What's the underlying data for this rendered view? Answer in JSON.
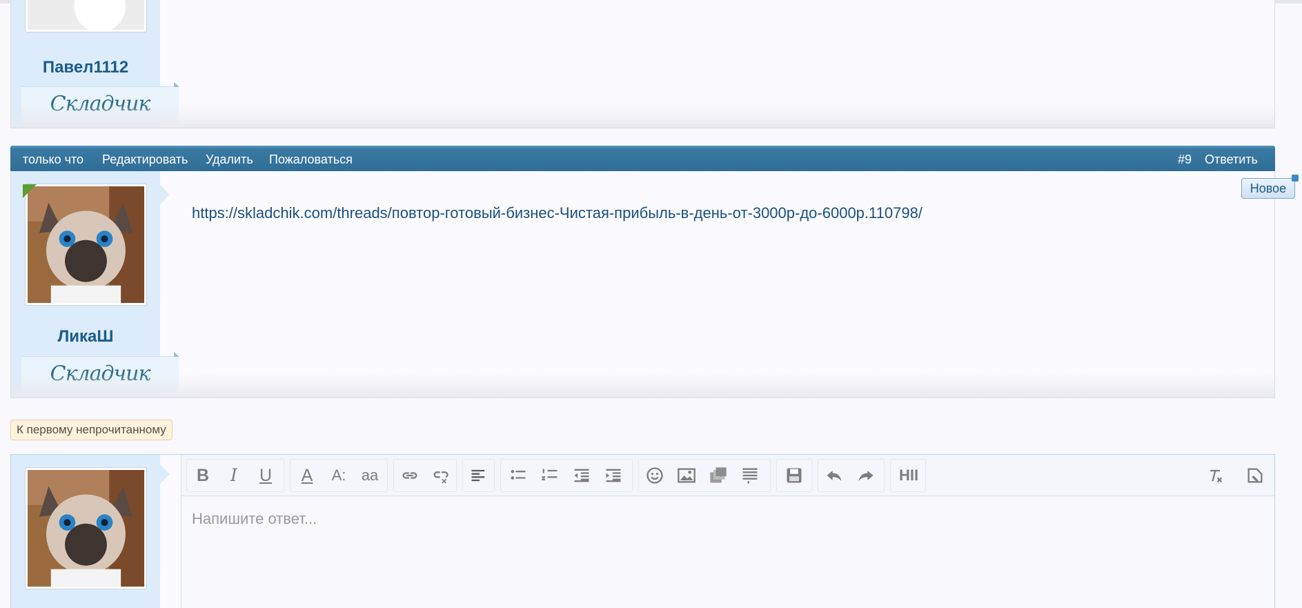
{
  "posts": [
    {
      "username": "Павел1112",
      "user_title": "Складчик"
    },
    {
      "meta": {
        "time": "только что",
        "edit": "Редактировать",
        "delete": "Удалить",
        "report": "Пожаловаться",
        "number": "#9",
        "reply": "Ответить"
      },
      "badge": "Новое",
      "content_link": "https://skladchik.com/threads/повтор-готовый-бизнес-Чистая-прибыль-в-день-от-3000р-до-6000р.110798/",
      "username": "ЛикаШ",
      "user_title": "Складчик"
    }
  ],
  "unread_button": "К первому непрочитанному",
  "editor": {
    "placeholder": "Напишите ответ...",
    "toolbar": {
      "bold": "B",
      "italic": "I",
      "underline": "U",
      "font_color": "A",
      "font_size": "A:",
      "font_family": "aa",
      "headers": "HII",
      "icons": [
        "bold-icon",
        "italic-icon",
        "underline-icon",
        "font-color-icon",
        "font-size-icon",
        "font-family-icon",
        "link-icon",
        "unlink-icon",
        "align-icon",
        "bullet-list-icon",
        "number-list-icon",
        "outdent-icon",
        "indent-icon",
        "smilie-icon",
        "image-icon",
        "media-icon",
        "more-icon",
        "save-draft-icon",
        "undo-icon",
        "redo-icon",
        "headers-icon",
        "remove-format-icon",
        "toggle-source-icon"
      ]
    }
  },
  "colors": {
    "bar": "#2f6d96",
    "username": "#1c5a88",
    "user_column": "#dcecfa",
    "unread_button_bg": "#fff3de"
  }
}
